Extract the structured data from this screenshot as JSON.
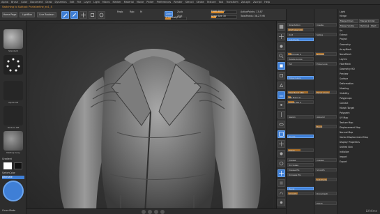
{
  "menubar": {
    "items": [
      "Alpha",
      "Brush",
      "Color",
      "Document",
      "Draw",
      "Dynamics",
      "Edit",
      "File",
      "Layer",
      "Light",
      "Macro",
      "Marker",
      "Material",
      "Movie",
      "Picker",
      "Preferences",
      "Render",
      "Stencil",
      "Stroke",
      "Texture",
      "Tool",
      "Transform",
      "Zplugin",
      "Zscript",
      "Help"
    ]
  },
  "subbar": {
    "status_text": "Switching to Subtool: Punisherline_ex1_S"
  },
  "toolbar": {
    "home_label": "Home Page",
    "lightbox_label": "LightBox",
    "live_boolean_label": "Live Boolean",
    "edit_label": "Edit",
    "draw_label": "Draw",
    "move_label": "Move",
    "scale_label": "Scale",
    "rotate_label": "Rotate",
    "mrgb_label": "Mrgb",
    "rgb_label": "Rgb",
    "m_label": "M",
    "zadd_label": "Zadd",
    "zsub_label": "Zsub",
    "zcut_label": "Zcut",
    "focal_label": "Focal Shift 0",
    "draw_size_label": "Draw Size 30",
    "z_intensity_label": "Z Intensity 25",
    "rgb_intensity_label": "Rgb Intensity 100",
    "active_points": "ActivePoints: 13.87",
    "total_points": "TotalPoints: 38.27 Mil",
    "restore_label": "Restore Custom UI",
    "store_config_label": "Store Config",
    "accent": "#d98a2b",
    "active_color": "#3f7fd6"
  },
  "lefttray": {
    "brush_labels": [
      "Standard",
      "Alpha Off",
      "Texture Off",
      "MatCap Gray"
    ],
    "gradient_label": "Gradient",
    "switch_color_label": "SwitchColor",
    "alternate_label": "Alternate",
    "curve_mode_label": "Curve Mode",
    "backface_label": "BackfaceMask"
  },
  "panel1": {
    "sections": [
      {
        "label": "Orientation",
        "value": ""
      },
      {
        "label": "XYZ Size 100",
        "value": ""
      },
      {
        "label": "Unit",
        "value": ""
      },
      {
        "label": "Subdivide",
        "value": ""
      },
      {
        "label": "Thickness 0",
        "value": ""
      },
      {
        "label": "Delete Loops",
        "value": ""
      },
      {
        "label": "Ext",
        "value": ""
      },
      {
        "label": "Edge Curve",
        "value": ""
      },
      {
        "label": "Max Bend 180",
        "value": ""
      },
      {
        "label": "Min Bend 0",
        "value": ""
      },
      {
        "label": "Curve Res 5",
        "value": ""
      },
      {
        "label": "Assign",
        "value": ""
      },
      {
        "label": "Divide",
        "value": ""
      },
      {
        "label": "Polish",
        "value": ""
      },
      {
        "label": "Crease",
        "value": ""
      },
      {
        "label": "Uncrease",
        "value": ""
      },
      {
        "label": "Crease PG",
        "value": ""
      },
      {
        "label": "Unrease PG",
        "value": ""
      },
      {
        "label": "Bevel",
        "value": ""
      },
      {
        "label": "Smooth",
        "value": ""
      }
    ]
  },
  "panel2": {
    "labels": [
      "Create",
      "Spline",
      "Groups",
      "Edge Loop",
      "Panel Loops",
      "Append",
      "Bevel",
      "Crease",
      "Smooth",
      "Subdivide",
      "Dynamesh",
      "Polish"
    ]
  },
  "panel3": {
    "top_labels": [
      "Light",
      "Merge",
      "Merge Down",
      "Merge Similar",
      "Merge Visible",
      "Remove",
      "Weld",
      "Uv",
      "Extract",
      "Project"
    ],
    "items": [
      "Geometry",
      "ArrayMesh",
      "NanoMesh",
      "Layers",
      "FiberMesh",
      "Geometry HD",
      "Preview",
      "Surface",
      "Deformation",
      "Masking",
      "Visibility",
      "Polygroups",
      "Contact",
      "Morph Target",
      "Polypaint",
      "UV Map",
      "Texture Map",
      "Displacement Map",
      "Normal Map",
      "Vector Displacement Map",
      "Display Properties",
      "Unified Skin",
      "Initialize",
      "Import",
      "Export"
    ]
  },
  "statusbar": {
    "logo": "Lifetime"
  }
}
